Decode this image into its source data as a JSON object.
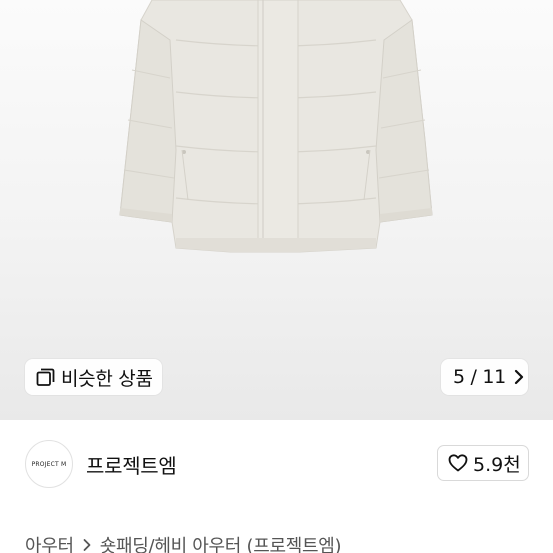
{
  "hero": {
    "image_icon": "jacket-product-photo",
    "similar_button_label": "비슷한 상품",
    "similar_icon": "copy-squares-icon",
    "counter_current": "5",
    "counter_total": "11",
    "counter_text": "5 / 11",
    "next_icon": "chevron-right-icon"
  },
  "seller": {
    "avatar_text": "PROJECT M",
    "name": "프로젝트엠"
  },
  "like": {
    "icon": "heart-outline-icon",
    "count": "5.9천"
  },
  "breadcrumb": {
    "items": [
      "아우터",
      "숏패딩/헤비 아우터 (프로젝트엠)"
    ],
    "separator_icon": "chevron-right-icon"
  },
  "colors": {
    "background": "#ffffff",
    "hero_bg": "#f3f3f3",
    "jacket": "#e8e6e0",
    "text": "#111111",
    "muted": "#555555",
    "border": "#d9d9d9"
  }
}
